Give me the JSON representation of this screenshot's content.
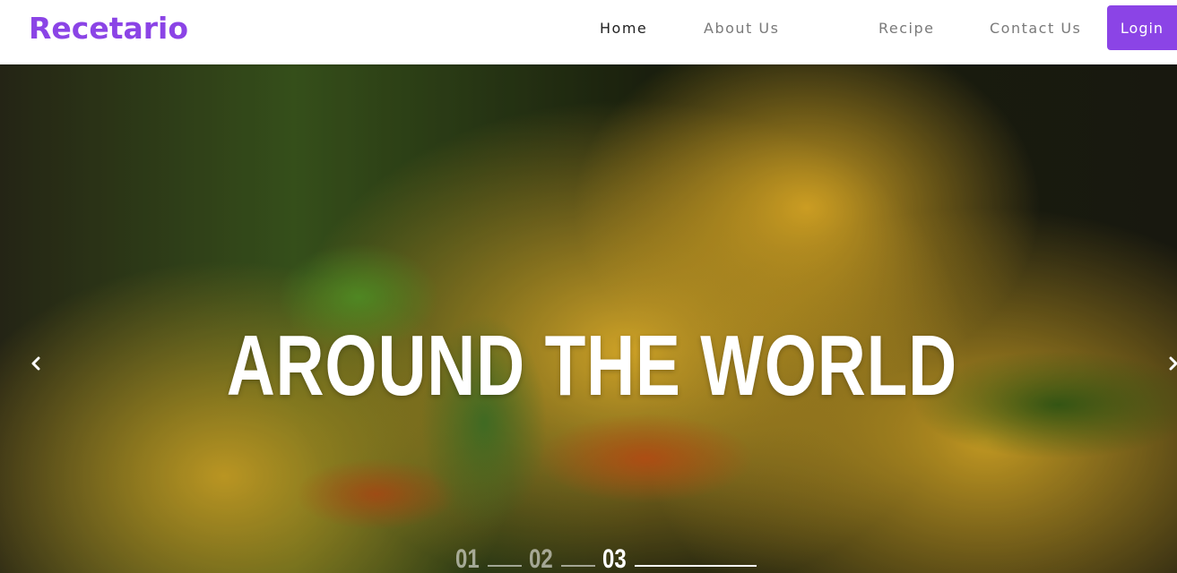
{
  "navbar": {
    "brand": "Recetario",
    "links": [
      {
        "label": "Home",
        "active": true
      },
      {
        "label": "About Us",
        "active": false
      },
      {
        "label": "Recipe",
        "active": false
      },
      {
        "label": "Contact Us",
        "active": false
      }
    ],
    "login_label": "Login"
  },
  "hero": {
    "title": "AROUND THE WORLD",
    "prev_icon": "chevron-left-icon",
    "next_icon": "chevron-right-icon",
    "indicators": [
      {
        "label": "01",
        "active": false
      },
      {
        "label": "02",
        "active": false
      },
      {
        "label": "03",
        "active": true
      }
    ]
  },
  "colors": {
    "brand": "#8b44e6",
    "nav_text": "#7a7a7a",
    "nav_active": "#222222",
    "hero_text": "#ffffff"
  }
}
